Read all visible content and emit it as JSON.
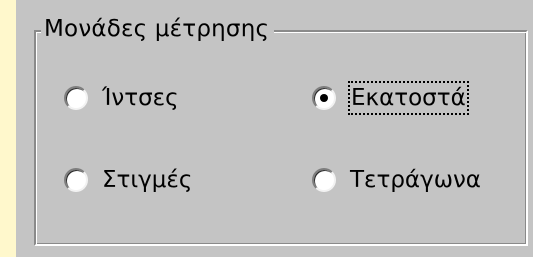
{
  "group": {
    "title": "Μονάδες μέτρησης"
  },
  "options": [
    {
      "label": "Ίντσες",
      "checked": false,
      "focused": false
    },
    {
      "label": "Εκατοστά",
      "checked": true,
      "focused": true
    },
    {
      "label": "Στιγμές",
      "checked": false,
      "focused": false
    },
    {
      "label": "Τετράγωνα",
      "checked": false,
      "focused": false
    }
  ],
  "colors": {
    "page_background": "#fff8cc",
    "dialog_face": "#c4c4c4"
  }
}
